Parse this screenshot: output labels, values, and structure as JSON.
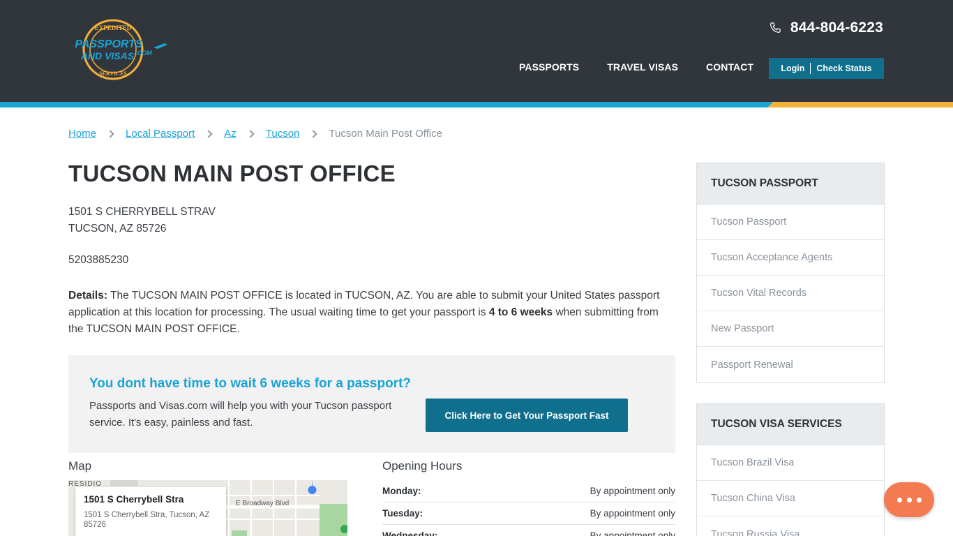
{
  "header": {
    "logo": {
      "top_text": "EXPEDITED",
      "main_text_1": "PASSPORTS",
      "main_text_2": "AND VISAS",
      "suffix": ".COM",
      "bottom_text": "SERVICES"
    },
    "phone": "844-804-6223",
    "nav": [
      "PASSPORTS",
      "TRAVEL VISAS",
      "CONTACT"
    ],
    "login_label": "Login",
    "check_status_label": "Check Status",
    "colors": {
      "header_bg": "#31363c",
      "accent_blue": "#1ba3d6",
      "accent_gold": "#f3b139",
      "button_teal": "#0f6f8c"
    }
  },
  "breadcrumb": {
    "items": [
      "Home",
      "Local Passport",
      "Az",
      "Tucson"
    ],
    "current": "Tucson Main Post Office"
  },
  "main": {
    "title": "TUCSON MAIN POST OFFICE",
    "address_line1": "1501 S CHERRYBELL STRAV",
    "address_line2": "TUCSON, AZ 85726",
    "phone": "5203885230",
    "details_label": "Details:",
    "details_text_1": " The TUCSON MAIN POST OFFICE is located in TUCSON, AZ. You are able to submit your United States passport application at this location for processing. The usual waiting time to get your passport is ",
    "details_bold": "4 to 6 weeks",
    "details_text_2": " when submitting from the TUCSON MAIN POST OFFICE."
  },
  "cta": {
    "title": "You dont have time to wait 6 weeks for a passport?",
    "text": "Passports and Visas.com will help you with your Tucson passport service. It's easy, painless and fast.",
    "button_label": "Click Here to Get Your Passport Fast"
  },
  "map": {
    "heading": "Map",
    "card_title": "1501 S Cherrybell Stra",
    "card_address": "1501 S Cherrybell Stra, Tucson, AZ 85726",
    "label_residio": "RESIDIO",
    "label_broadway": "E Broadway Blvd"
  },
  "hours": {
    "heading": "Opening Hours",
    "rows": [
      {
        "day": "Monday:",
        "value": "By appointment only"
      },
      {
        "day": "Tuesday:",
        "value": "By appointment only"
      },
      {
        "day": "Wednesday:",
        "value": "By appointment only"
      }
    ]
  },
  "sidebar": {
    "passport_box": {
      "title": "TUCSON PASSPORT",
      "items": [
        "Tucson Passport",
        "Tucson Acceptance Agents",
        "Tucson Vital Records",
        "New Passport",
        "Passport Renewal"
      ]
    },
    "visa_box": {
      "title": "TUCSON VISA SERVICES",
      "items": [
        "Tucson Brazil Visa",
        "Tucson China Visa",
        "Tucson Russia Visa"
      ]
    }
  },
  "chat": {
    "icon": "chat-dots-icon",
    "color": "#f47a52"
  }
}
